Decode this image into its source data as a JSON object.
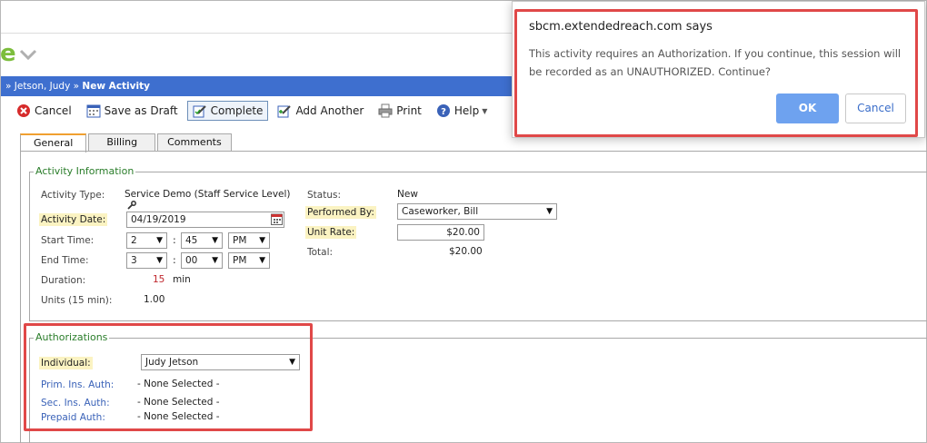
{
  "logo": {
    "fragment": "e"
  },
  "breadcrumb": {
    "parent": "» Jetson, Judy",
    "separator": "»",
    "current": "New Activity"
  },
  "toolbar": {
    "cancel": "Cancel",
    "save_draft": "Save as Draft",
    "complete": "Complete",
    "add_another": "Add Another",
    "print": "Print",
    "help": "Help"
  },
  "tabs": [
    "General",
    "Billing",
    "Comments"
  ],
  "activity_info": {
    "legend": "Activity Information",
    "activity_type_label": "Activity Type:",
    "activity_type_value": "Service Demo (Staff Service Level)",
    "activity_date_label": "Activity Date:",
    "activity_date_value": "04/19/2019",
    "start_time_label": "Start Time:",
    "start_hour": "2",
    "start_min": "45",
    "start_ampm": "PM",
    "end_time_label": "End Time:",
    "end_hour": "3",
    "end_min": "00",
    "end_ampm": "PM",
    "duration_label": "Duration:",
    "duration_value": "15",
    "duration_unit": "min",
    "units_label": "Units (15 min):",
    "units_value": "1.00",
    "status_label": "Status:",
    "status_value": "New",
    "performed_by_label": "Performed By:",
    "performed_by_value": "Caseworker, Bill",
    "unit_rate_label": "Unit Rate:",
    "unit_rate_value": "$20.00",
    "total_label": "Total:",
    "total_value": "$20.00"
  },
  "authorizations": {
    "legend": "Authorizations",
    "individual_label": "Individual:",
    "individual_value": "Judy Jetson",
    "prim_label": "Prim. Ins. Auth:",
    "prim_value": "- None Selected -",
    "sec_label": "Sec. Ins. Auth:",
    "sec_value": "- None Selected -",
    "prepaid_label": "Prepaid Auth:",
    "prepaid_value": "- None Selected -"
  },
  "dialog": {
    "title": "sbcm.extendedreach.com says",
    "message": "This activity requires an Authorization.  If you continue, this session will be recorded as an UNAUTHORIZED.  Continue?",
    "ok": "OK",
    "cancel": "Cancel"
  },
  "colors": {
    "breadcrumb_bg": "#3e6fcf",
    "legend_green": "#2a7d2a",
    "highlight_box": "#e04848",
    "ok_button": "#6ea2ef"
  }
}
